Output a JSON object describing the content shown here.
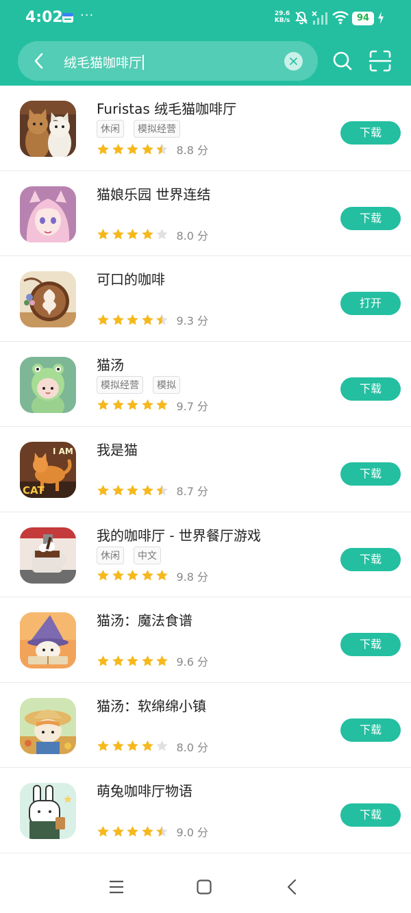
{
  "status_bar": {
    "time": "4:02",
    "more": "···",
    "net_speed_value": "29.6",
    "net_speed_unit": "KB/s",
    "battery": "94",
    "notif_icon": "message-icon"
  },
  "search": {
    "query": "绒毛猫咖啡厅",
    "back_icon": "back-arrow-icon",
    "clear_icon": "clear-icon",
    "search_icon": "search-icon",
    "scan_icon": "scan-icon"
  },
  "colors": {
    "accent": "#23bfa0",
    "star": "#f6b81b",
    "star_empty": "#e0e0e0"
  },
  "apps": [
    {
      "name": "Furistas 绒毛猫咖啡厅",
      "tags": [
        "休闲",
        "模拟经营"
      ],
      "stars": 4.5,
      "score": "8.8 分",
      "action": "下载",
      "icon": "furistas-cats-icon"
    },
    {
      "name": "猫娘乐园 世界连结",
      "tags": [],
      "stars": 4,
      "score": "8.0 分",
      "action": "下载",
      "icon": "catgirl-icon"
    },
    {
      "name": "可口的咖啡",
      "tags": [],
      "stars": 4.5,
      "score": "9.3 分",
      "action": "打开",
      "icon": "latte-art-icon"
    },
    {
      "name": "猫汤",
      "tags": [
        "模拟经营",
        "模拟"
      ],
      "stars": 5,
      "score": "9.7 分",
      "action": "下载",
      "icon": "frog-hood-icon"
    },
    {
      "name": "我是猫",
      "tags": [],
      "stars": 4.5,
      "score": "8.7 分",
      "action": "下载",
      "icon": "i-am-cat-icon"
    },
    {
      "name": "我的咖啡厅 - 世界餐厅游戏",
      "tags": [
        "休闲",
        "中文"
      ],
      "stars": 5,
      "score": "9.8 分",
      "action": "下载",
      "icon": "hot-chocolate-icon"
    },
    {
      "name": "猫汤：魔法食谱",
      "tags": [],
      "stars": 5,
      "score": "9.6 分",
      "action": "下载",
      "icon": "wizard-cat-icon"
    },
    {
      "name": "猫汤：软绵绵小镇",
      "tags": [],
      "stars": 4,
      "score": "8.0 分",
      "action": "下载",
      "icon": "farmer-cat-icon"
    },
    {
      "name": "萌兔咖啡厅物语",
      "tags": [],
      "stars": 4.5,
      "score": "9.0 分",
      "action": "下载",
      "icon": "bunny-barista-icon"
    }
  ],
  "nav": {
    "menu_icon": "menu-icon",
    "home_icon": "home-icon",
    "back_icon": "back-icon"
  }
}
